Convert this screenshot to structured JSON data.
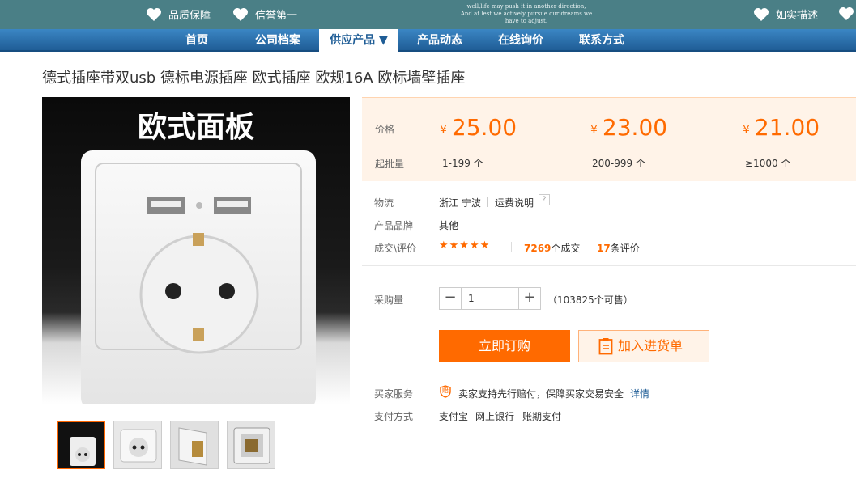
{
  "topbar": {
    "badge1": "品质保障",
    "badge2": "信誉第一",
    "slogan_line1": "well,life may push it in another direction,",
    "slogan_line2": "And at lest we actively pursue our dreams we have to adjust.",
    "badge3": "如实描述"
  },
  "nav": [
    {
      "label": "首页"
    },
    {
      "label": "公司档案"
    },
    {
      "label": "供应产品 ▼"
    },
    {
      "label": "产品动态"
    },
    {
      "label": "在线询价"
    },
    {
      "label": "联系方式"
    }
  ],
  "product": {
    "title": "德式插座带双usb 德标电源插座 欧式插座 欧规16A 欧标墙壁插座",
    "image_caption": "欧式面板"
  },
  "pricing": {
    "price_label": "价格",
    "moq_label": "起批量",
    "currency": "¥",
    "tiers": [
      {
        "price": "25.00",
        "range": "1-199 个"
      },
      {
        "price": "23.00",
        "range": "200-999 个"
      },
      {
        "price": "21.00",
        "range": "≥1000 个"
      }
    ]
  },
  "logistics": {
    "label": "物流",
    "location": "浙江 宁波",
    "freight_link": "运费说明",
    "help": "?"
  },
  "brand": {
    "label": "产品品牌",
    "value": "其他"
  },
  "deals": {
    "label": "成交\\评价",
    "stars": "★★★★★",
    "deals_count": "7269",
    "deals_suffix": "个成交",
    "reviews_count": "17",
    "reviews_suffix": "条评价"
  },
  "purchase": {
    "label": "采购量",
    "minus": "−",
    "quantity": "1",
    "plus": "+",
    "stock": "（103825个可售）",
    "buy_now": "立即订购",
    "add_to_list": "加入进货单"
  },
  "service": {
    "label": "买家服务",
    "badge": "赔",
    "text": "卖家支持先行赔付，保障买家交易安全",
    "details": "详情"
  },
  "payment": {
    "label": "支付方式",
    "methods": [
      "支付宝",
      "网上银行",
      "账期支付"
    ]
  },
  "colors": {
    "accent": "#ff6a00",
    "topbar": "#4a7f86",
    "nav": "#1f5d96"
  }
}
